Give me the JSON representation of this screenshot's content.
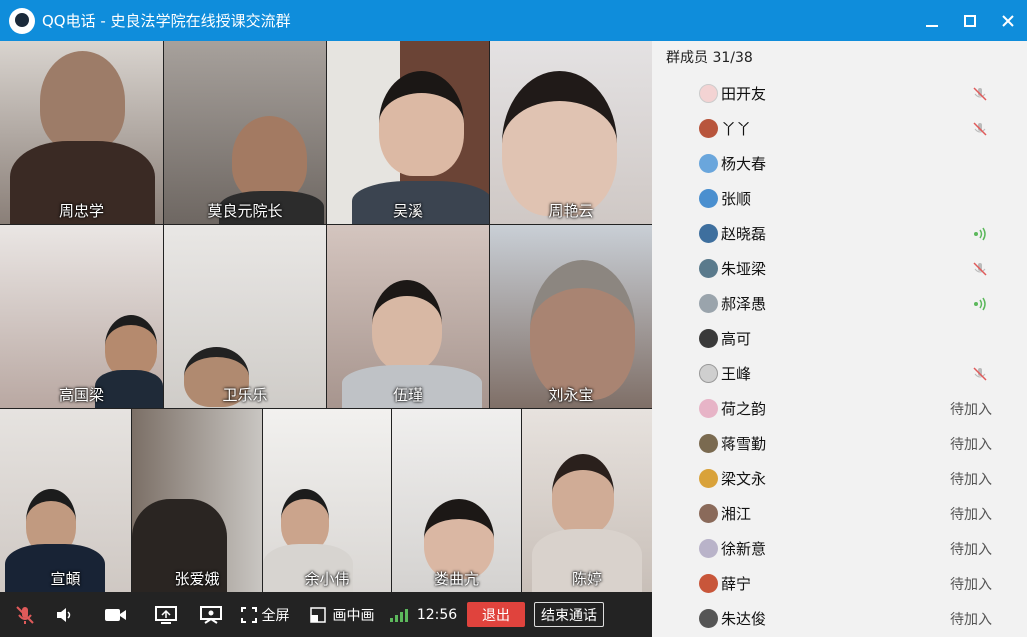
{
  "window": {
    "title": "QQ电话 - 史良法学院在线授课交流群"
  },
  "videos": [
    {
      "name": "周忠学"
    },
    {
      "name": "莫良元院长"
    },
    {
      "name": "吴溪"
    },
    {
      "name": "周艳云"
    },
    {
      "name": "高国梁"
    },
    {
      "name": "卫乐乐"
    },
    {
      "name": "伍瑾"
    },
    {
      "name": "刘永宝"
    },
    {
      "name": "宣頔"
    },
    {
      "name": "张爱娥"
    },
    {
      "name": "余小伟"
    },
    {
      "name": "娄曲亢"
    },
    {
      "name": "陈婷"
    }
  ],
  "toolbar": {
    "fullscreen": "全屏",
    "pip": "画中画",
    "time": "12:56",
    "exit": "退出",
    "end_call": "结束通话"
  },
  "members": {
    "header": "群成员 31/38",
    "list": [
      {
        "name": "田开友",
        "status": "muted",
        "status_text": ""
      },
      {
        "name": "丫丫",
        "status": "muted",
        "status_text": ""
      },
      {
        "name": "杨大春",
        "status": "none",
        "status_text": ""
      },
      {
        "name": "张顺",
        "status": "none",
        "status_text": ""
      },
      {
        "name": "赵晓磊",
        "status": "speaking",
        "status_text": ""
      },
      {
        "name": "朱垭梁",
        "status": "muted",
        "status_text": ""
      },
      {
        "name": "郝泽愚",
        "status": "speaking",
        "status_text": ""
      },
      {
        "name": "高可",
        "status": "none",
        "status_text": ""
      },
      {
        "name": "王峰",
        "status": "muted",
        "status_text": ""
      },
      {
        "name": "荷之韵",
        "status": "pending",
        "status_text": "待加入"
      },
      {
        "name": "蒋雪勤",
        "status": "pending",
        "status_text": "待加入"
      },
      {
        "name": "梁文永",
        "status": "pending",
        "status_text": "待加入"
      },
      {
        "name": "湘江",
        "status": "pending",
        "status_text": "待加入"
      },
      {
        "name": "徐新意",
        "status": "pending",
        "status_text": "待加入"
      },
      {
        "name": "薛宁",
        "status": "pending",
        "status_text": "待加入"
      },
      {
        "name": "朱达俊",
        "status": "pending",
        "status_text": "待加入"
      }
    ]
  },
  "colors": {
    "titlebar": "#0f8ddb",
    "exit": "#e0433d",
    "speaking": "#5cb85c",
    "muted": "#e05a5a"
  }
}
